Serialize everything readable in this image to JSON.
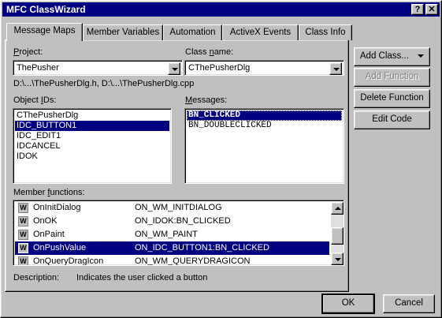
{
  "window": {
    "title": "MFC ClassWizard",
    "help_label": "?",
    "close_label": "✕"
  },
  "tabs": [
    {
      "label": "Message Maps",
      "active": true
    },
    {
      "label": "Member Variables",
      "active": false
    },
    {
      "label": "Automation",
      "active": false
    },
    {
      "label": "ActiveX Events",
      "active": false
    },
    {
      "label": "Class Info",
      "active": false
    }
  ],
  "project": {
    "label_pre": "",
    "label_ul": "P",
    "label_post": "roject:",
    "value": "ThePusher"
  },
  "class_name": {
    "label_pre": "Class ",
    "label_ul": "n",
    "label_post": "ame:",
    "value": "CThePusherDlg"
  },
  "file_path": "D:\\...\\ThePusherDlg.h, D:\\...\\ThePusherDlg.cpp",
  "object_ids": {
    "label_pre": "Object ",
    "label_ul": "I",
    "label_post": "Ds:",
    "items": [
      "CThePusherDlg",
      "IDC_BUTTON1",
      "IDC_EDIT1",
      "IDCANCEL",
      "IDOK"
    ],
    "selected_index": 1
  },
  "messages": {
    "label_pre": "",
    "label_ul": "M",
    "label_post": "essages:",
    "items": [
      "BN_CLICKED",
      "BN_DOUBLECLICKED"
    ],
    "selected_index": 0
  },
  "member_functions": {
    "label_pre": "Member ",
    "label_ul": "f",
    "label_post": "unctions:",
    "rows": [
      {
        "type": "W",
        "name": "OnInitDialog",
        "handler": "ON_WM_INITDIALOG"
      },
      {
        "type": "W",
        "name": "OnOK",
        "handler": "ON_IDOK:BN_CLICKED"
      },
      {
        "type": "W",
        "name": "OnPaint",
        "handler": "ON_WM_PAINT"
      },
      {
        "type": "W",
        "name": "OnPushValue",
        "handler": "ON_IDC_BUTTON1:BN_CLICKED"
      },
      {
        "type": "W",
        "name": "OnQueryDragIcon",
        "handler": "ON_WM_QUERYDRAGICON"
      }
    ],
    "selected_index": 3
  },
  "description": {
    "label": "Description:",
    "text": "Indicates the user clicked a button"
  },
  "buttons": {
    "add_class": "Add Class...",
    "add_function": "Add Function",
    "delete_function": "Delete Function",
    "edit_code": "Edit Code",
    "ok": "OK",
    "cancel": "Cancel"
  }
}
